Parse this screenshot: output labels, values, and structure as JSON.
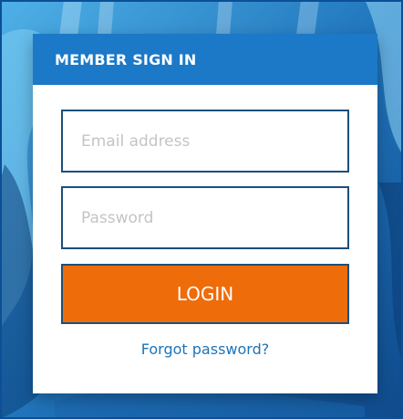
{
  "form": {
    "title": "MEMBER SIGN IN",
    "email_placeholder": "Email address",
    "email_value": "",
    "password_placeholder": "Password",
    "password_value": "",
    "login_label": "LOGIN",
    "forgot_label": "Forgot password?"
  },
  "colors": {
    "header_bg": "#1b79c7",
    "button_bg": "#ee6c0a",
    "link": "#1e73b6",
    "background": "#1c5fa3"
  }
}
